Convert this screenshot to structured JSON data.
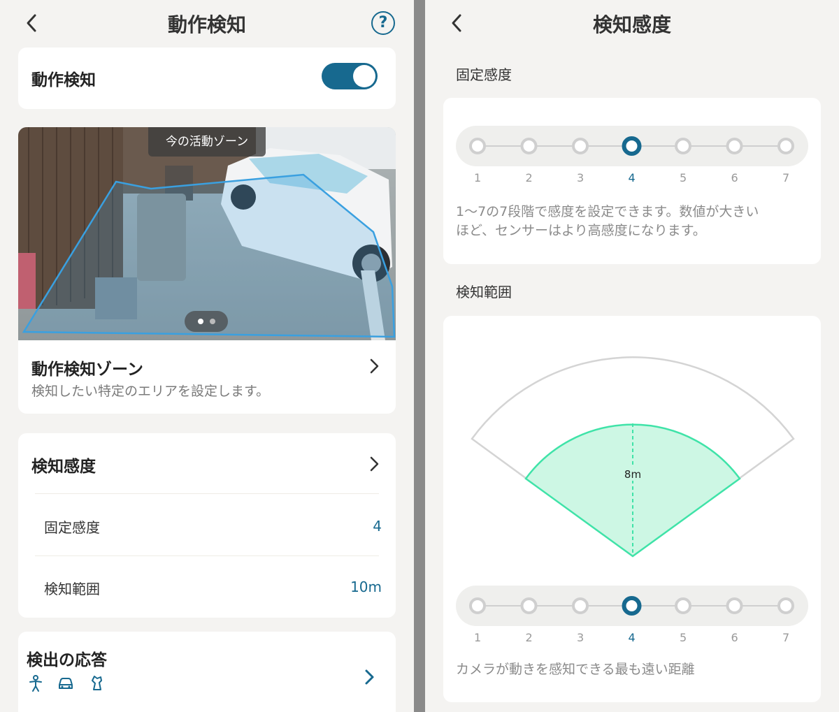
{
  "left": {
    "header_title": "動作検知",
    "motion_toggle_label": "動作検知",
    "motion_toggle_on": true,
    "zone_tag": "今の活動ゾーン",
    "zone_title": "動作検知ゾーン",
    "zone_desc": "検知したい特定のエリアを設定します。",
    "sensitivity_title": "検知感度",
    "fixed_label": "固定感度",
    "fixed_value": "4",
    "range_label": "検知範囲",
    "range_value": "10m",
    "response_title": "検出の応答",
    "response_icons": [
      "person-icon",
      "car-icon",
      "animal-icon"
    ]
  },
  "right": {
    "header_title": "検知感度",
    "fixed_section": "固定感度",
    "fixed_selected": 4,
    "scale": [
      "1",
      "2",
      "3",
      "4",
      "5",
      "6",
      "7"
    ],
    "fixed_desc_line1": "1〜7の7段階で感度を設定できます。数値が大きい",
    "fixed_desc_line2": "ほど、センサーはより高感度になります。",
    "range_section": "検知範囲",
    "range_marker": "8m",
    "range_selected": 4,
    "range_desc": "カメラが動きを感知できる最も遠い距離"
  },
  "colors": {
    "accent": "#17698f",
    "zone": "#3aa0e0",
    "range_fill": "#cdf7e4",
    "range_stroke": "#3fe3a8"
  }
}
